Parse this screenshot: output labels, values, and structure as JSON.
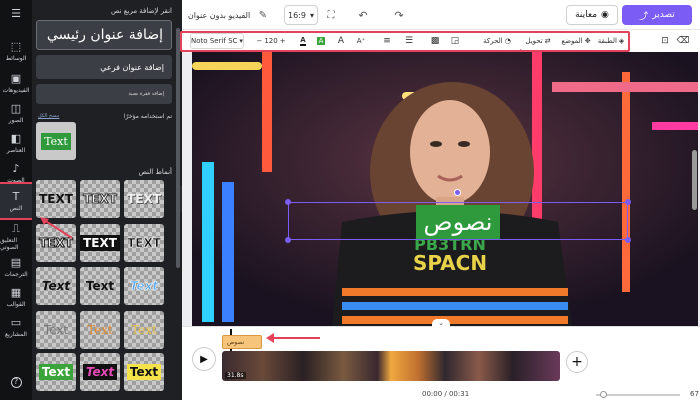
{
  "rail": {
    "items": [
      {
        "label": "الوسائط",
        "icon": "⬚"
      },
      {
        "label": "الفيديوهات",
        "icon": "▣"
      },
      {
        "label": "الصور",
        "icon": "◫"
      },
      {
        "label": "العناصر",
        "icon": "◧"
      },
      {
        "label": "الصوت",
        "icon": "♪"
      },
      {
        "label": "النص",
        "icon": "T"
      },
      {
        "label": "التعليق الصوتي",
        "icon": "⎍"
      },
      {
        "label": "الترجمات",
        "icon": "▤"
      },
      {
        "label": "القوالب",
        "icon": "▦"
      },
      {
        "label": "المشاريع",
        "icon": "▭"
      }
    ],
    "help_icon": "?"
  },
  "panel": {
    "hint": "انقر لإضافة مربع نص",
    "add_title": "إضافة عنوان رئيسي",
    "add_subtitle": "إضافة عنوان فرعي",
    "add_body": "إضافة فقرة نصية",
    "recent_label": "تم استخدامه مؤخرًا",
    "clear_all": "مسح الكل",
    "recent_text": "Text",
    "styles_label": "أنماط النص",
    "style_tiles": [
      "TEXT",
      "TEXT",
      "TEXT",
      "TEXT",
      "TEXT",
      "TEXT",
      "Text",
      "Text",
      "Text",
      "Text",
      "Text",
      "Text",
      "Text",
      "Text",
      "Text"
    ]
  },
  "header": {
    "title": "الفيديو بدون عنوان",
    "ratio": "16:9",
    "preview": "معاينة",
    "export": "تصدير"
  },
  "toolbar": {
    "font": "Noto Serif SC",
    "size": "120",
    "animation": "الحركة",
    "transform": "تحويل",
    "position": "الموضع",
    "layer": "الطبقة"
  },
  "canvas": {
    "overlay_text": "نصوص",
    "shirt_line1": "SPACN",
    "shirt_line2": "PB3TRN"
  },
  "timeline": {
    "text_clip": "نصوص",
    "clip_duration": "31.8s",
    "time": "00:00 / 00:31",
    "zoom": "67"
  },
  "colors": {
    "accent": "#e4425a",
    "export_bg": "#7b5cf5",
    "text_box_green": "#2f9a3c",
    "text_clip_bg": "#f6c47a"
  }
}
